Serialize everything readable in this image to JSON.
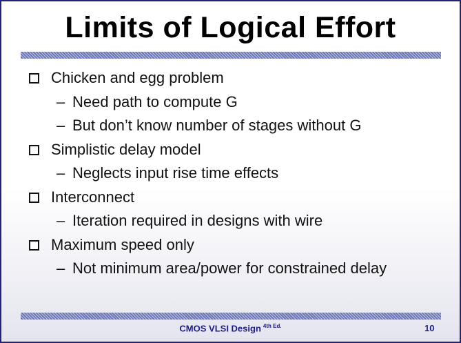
{
  "slide": {
    "title": "Limits of Logical Effort",
    "bullets": [
      {
        "level": 1,
        "marker": "checkbox-icon",
        "text": "Chicken and egg problem"
      },
      {
        "level": 2,
        "marker": "–",
        "text": "Need path to compute G"
      },
      {
        "level": 2,
        "marker": "–",
        "text": "But don’t know number of stages without G"
      },
      {
        "level": 1,
        "marker": "checkbox-icon",
        "text": "Simplistic delay model"
      },
      {
        "level": 2,
        "marker": "–",
        "text": "Neglects input rise time effects"
      },
      {
        "level": 1,
        "marker": "checkbox-icon",
        "text": "Interconnect"
      },
      {
        "level": 2,
        "marker": "–",
        "text": "Iteration required in designs with wire"
      },
      {
        "level": 1,
        "marker": "checkbox-icon",
        "text": "Maximum speed only"
      },
      {
        "level": 2,
        "marker": "–",
        "text": "Not minimum area/power for constrained delay"
      }
    ]
  },
  "footer": {
    "book": "CMOS VLSI Design",
    "edition": "4th Ed.",
    "page_number": "10"
  },
  "colors": {
    "border": "#23237a",
    "rule": "#6f78b6",
    "footer_text": "#1b1b8a"
  }
}
